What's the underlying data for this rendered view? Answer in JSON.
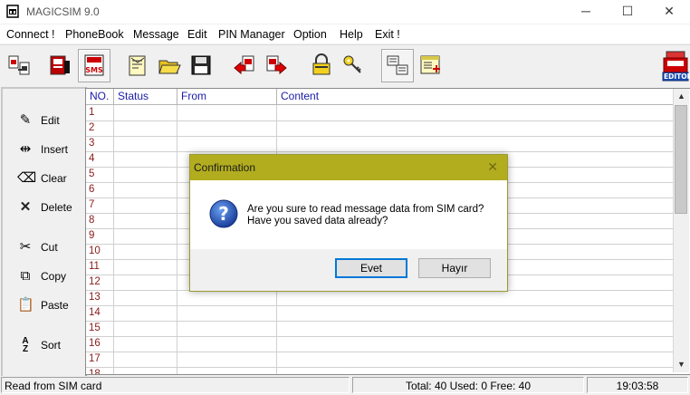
{
  "window": {
    "title": "MAGICSIM 9.0",
    "controls": {
      "minimize": "─",
      "maximize": "☐",
      "close": "✕"
    }
  },
  "menu": [
    "Connect !",
    "PhoneBook",
    "Message",
    "Edit",
    "PIN Manager",
    "Option",
    "Help",
    "Exit !"
  ],
  "toolbar": {
    "icons": [
      "connect-sim-icon",
      "phonebook-sim-icon",
      "sms-sim-icon",
      "new-message-icon",
      "open-folder-icon",
      "save-disk-icon",
      "import-icon",
      "export-icon",
      "lock-icon",
      "key-icon",
      "transfer-icon",
      "add-list-icon",
      "editor-icon"
    ],
    "editor_label": "EDITOR"
  },
  "side_buttons": [
    {
      "label": "Edit",
      "icon": "edit-icon"
    },
    {
      "label": "Insert",
      "icon": "insert-icon"
    },
    {
      "label": "Clear",
      "icon": "eraser-icon"
    },
    {
      "label": "Delete",
      "icon": "delete-icon"
    },
    {
      "label": "Cut",
      "icon": "scissors-icon"
    },
    {
      "label": "Copy",
      "icon": "copy-icon"
    },
    {
      "label": "Paste",
      "icon": "paste-icon"
    },
    {
      "label": "Sort",
      "icon": "sort-az-icon"
    }
  ],
  "table": {
    "columns": [
      "NO.",
      "Status",
      "From",
      "Content"
    ],
    "rows": [
      "1",
      "2",
      "3",
      "4",
      "5",
      "6",
      "7",
      "8",
      "9",
      "10",
      "11",
      "12",
      "13",
      "14",
      "15",
      "16",
      "17",
      "18"
    ]
  },
  "status": {
    "message": "Read from SIM card",
    "counts": "Total: 40  Used: 0  Free: 40",
    "time": "19:03:58"
  },
  "dialog": {
    "title": "Confirmation",
    "line1": "Are you sure to read message data from SIM card?",
    "line2": "Have you saved data already?",
    "yes": "Evet",
    "no": "Hayır",
    "icon": "question-icon"
  },
  "colors": {
    "dialog_title_bar": "#b2ad1f",
    "row_number": "#8a1a1a",
    "header_text": "#1a1aa8"
  }
}
